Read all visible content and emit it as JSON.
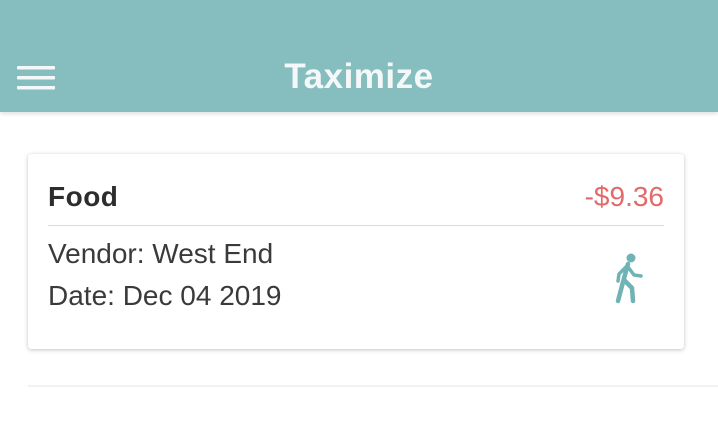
{
  "app_bar": {
    "title": "Taximize",
    "menu_icon": "hamburger-menu-icon",
    "background_color": "#86bebf"
  },
  "expense_card": {
    "category": "Food",
    "amount": "-$9.36",
    "amount_color": "#e26a6a",
    "vendor": "Vendor: West End",
    "date": "Date: Dec 04 2019",
    "transport_icon": "walking-person-icon"
  }
}
